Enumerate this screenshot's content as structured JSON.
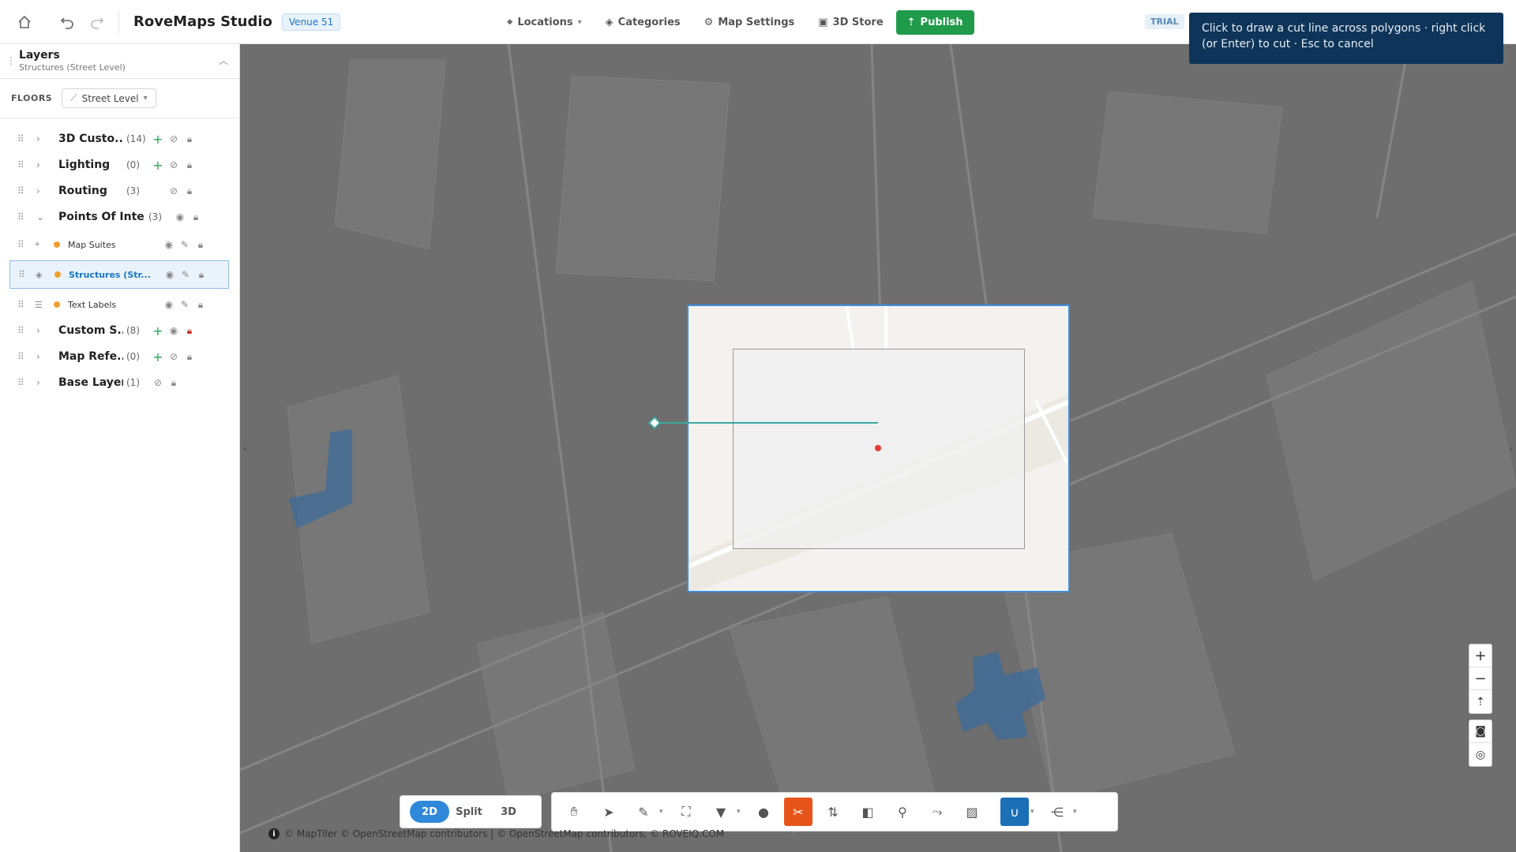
{
  "app": {
    "title": "RoveMaps Studio",
    "venue": "Venue 51",
    "trial": "TRIAL"
  },
  "nav": {
    "locations": "Locations",
    "categories": "Categories",
    "map_settings": "Map Settings",
    "store": "3D Store",
    "publish": "Publish"
  },
  "tooltip": {
    "text": "Click to draw a cut line across polygons · right click (or Enter) to cut · Esc to cancel"
  },
  "sidebar": {
    "title": "Layers",
    "subtitle": "Structures (Street Level)",
    "floors_label": "FLOORS",
    "floor_value": "Street Level",
    "layers": [
      {
        "name": "3D Custo...",
        "count": "(14)"
      },
      {
        "name": "Lighting",
        "count": "(0)"
      },
      {
        "name": "Routing",
        "count": "(3)"
      },
      {
        "name": "Points Of Inte...",
        "count": "(3)"
      },
      {
        "name": "Custom S...",
        "count": "(8)"
      },
      {
        "name": "Map Refe...",
        "count": "(0)"
      },
      {
        "name": "Base Layer",
        "count": "(1)"
      }
    ],
    "sublayers": [
      {
        "name": "Map Suites"
      },
      {
        "name": "Structures (Str..."
      },
      {
        "name": "Text Labels"
      }
    ]
  },
  "view_toggle": {
    "two_d": "2D",
    "split": "Split",
    "three_d": "3D"
  },
  "attribution": "© MapTiler © OpenStreetMap contributors | © OpenStreetMap contributors, © ROVEIQ.COM",
  "colors": {
    "accent": "#2f88d8",
    "publish": "#1f9b4a",
    "cut_tool": "#e6541a",
    "tooltip_bg": "#0e3559"
  }
}
